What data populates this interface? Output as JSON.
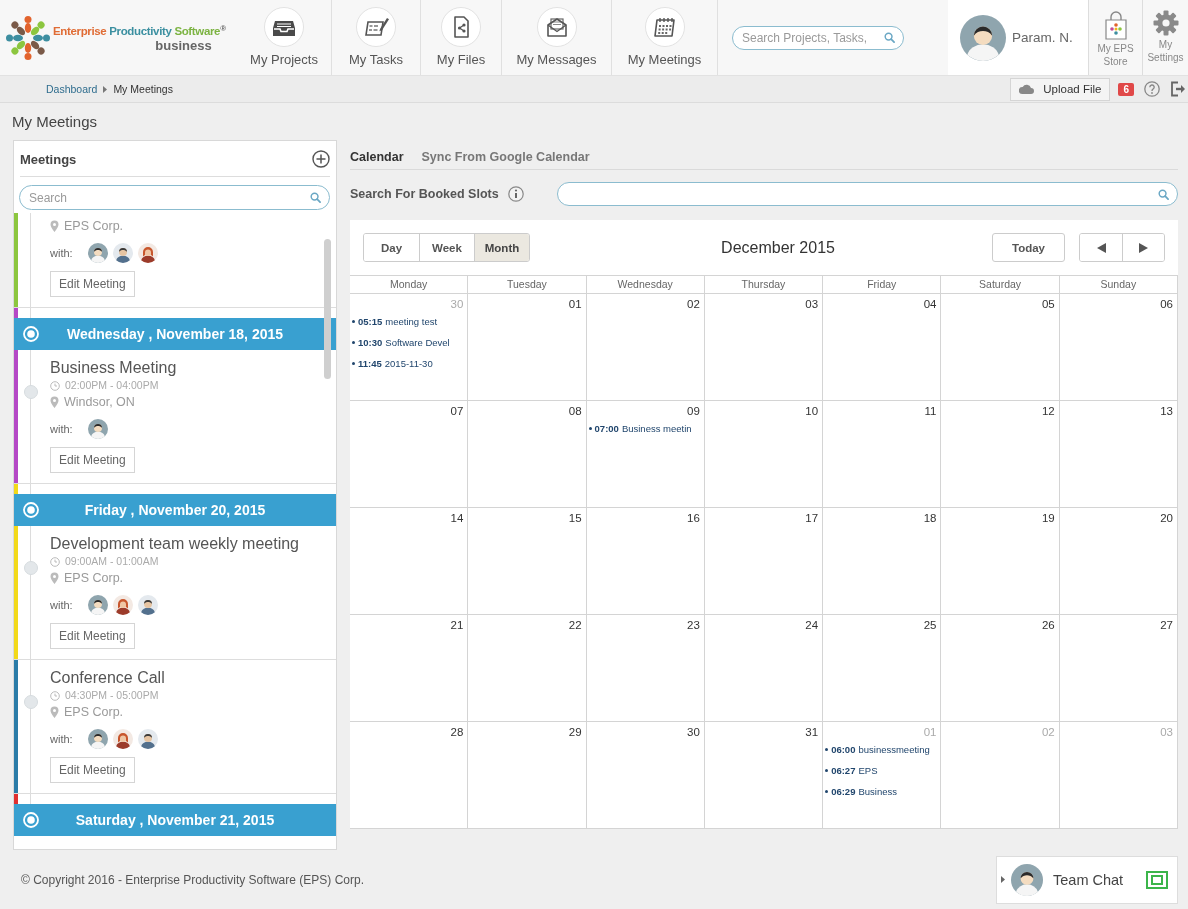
{
  "header": {
    "logo": {
      "words": [
        "Enterprise",
        "Productivity",
        "Software$^{®}$"
      ],
      "tagline": "business"
    },
    "nav": [
      {
        "label": "My Projects"
      },
      {
        "label": "My Tasks"
      },
      {
        "label": "My Files"
      },
      {
        "label": "My Messages"
      },
      {
        "label": "My Meetings"
      }
    ],
    "search": {
      "placeholder": "Search Projects, Tasks,"
    },
    "user": {
      "name": "Param. N."
    },
    "store": {
      "label": "My EPS Store"
    },
    "settings": {
      "label": "My Settings"
    }
  },
  "breadcrumb": [
    {
      "label": "Dashboard",
      "kind": "link"
    },
    {
      "label": "My Meetings",
      "kind": "current"
    }
  ],
  "toolbar": {
    "upload": "Upload File",
    "notifications": "6"
  },
  "page_title": "My Meetings",
  "meetings": {
    "title": "Meetings",
    "search": {
      "placeholder": "Search"
    },
    "list": [
      {
        "kind": "meeting",
        "location": "EPS Corp.",
        "with": "with:",
        "attendees": [
          {
            "kind": "man"
          },
          {
            "kind": "boy"
          },
          {
            "kind": "woman"
          }
        ],
        "button": "Edit Meeting",
        "color": "#8cc63f"
      },
      {
        "kind": "date",
        "label": "Wednesday , November 18, 2015",
        "color": "#b548c6"
      },
      {
        "kind": "meeting",
        "title": "Business Meeting",
        "time": "02:00PM - 04:00PM",
        "location": "Windsor, ON",
        "with": "with:",
        "attendees": [
          {
            "kind": "man"
          }
        ],
        "button": "Edit Meeting",
        "color": "#b548c6"
      },
      {
        "kind": "date",
        "label": "Friday , November 20, 2015",
        "color": "#f2d91a"
      },
      {
        "kind": "meeting",
        "title": "Development team weekly meeting",
        "time": "09:00AM - 01:00AM",
        "location": "EPS Corp.",
        "with": "with:",
        "attendees": [
          {
            "kind": "man"
          },
          {
            "kind": "woman"
          },
          {
            "kind": "boy"
          }
        ],
        "button": "Edit Meeting",
        "color": "#f2d91a"
      },
      {
        "kind": "meeting",
        "title": "Conference Call",
        "time": "04:30PM - 05:00PM",
        "location": "EPS Corp.",
        "with": "with:",
        "attendees": [
          {
            "kind": "man"
          },
          {
            "kind": "woman"
          },
          {
            "kind": "boy"
          }
        ],
        "button": "Edit Meeting",
        "color": "#2b7ca8"
      },
      {
        "kind": "date",
        "label": "Saturday , November 21, 2015",
        "color": "#e03030"
      }
    ]
  },
  "calendar_tabs": [
    {
      "label": "Calendar",
      "selected": true
    },
    {
      "label": "Sync From Google Calendar",
      "selected": false
    }
  ],
  "slot_search": {
    "label": "Search For Booked Slots"
  },
  "calendar": {
    "views": [
      {
        "label": "Day",
        "selected": false
      },
      {
        "label": "Week",
        "selected": false
      },
      {
        "label": "Month",
        "selected": true
      }
    ],
    "title": "December 2015",
    "today": "Today",
    "weekdays": [
      "Monday",
      "Tuesday",
      "Wednesday",
      "Thursday",
      "Friday",
      "Saturday",
      "Sunday"
    ],
    "weeks": [
      [
        {
          "day": "30",
          "other_month": true,
          "events": [
            {
              "time": "05:15",
              "title": "meeting test"
            },
            {
              "time": "10:30",
              "title": "Software Devel"
            },
            {
              "time": "11:45",
              "title": "2015-11-30"
            }
          ]
        },
        {
          "day": "01",
          "other_month": false
        },
        {
          "day": "02",
          "other_month": false
        },
        {
          "day": "03",
          "other_month": false
        },
        {
          "day": "04",
          "other_month": false
        },
        {
          "day": "05",
          "other_month": false
        },
        {
          "day": "06",
          "other_month": false
        }
      ],
      [
        {
          "day": "07",
          "other_month": false
        },
        {
          "day": "08",
          "other_month": false
        },
        {
          "day": "09",
          "other_month": false,
          "events": [
            {
              "time": "07:00",
              "title": "Business meetin"
            }
          ]
        },
        {
          "day": "10",
          "other_month": false
        },
        {
          "day": "11",
          "other_month": false
        },
        {
          "day": "12",
          "other_month": false
        },
        {
          "day": "13",
          "other_month": false
        }
      ],
      [
        {
          "day": "14",
          "other_month": false
        },
        {
          "day": "15",
          "other_month": false
        },
        {
          "day": "16",
          "other_month": false
        },
        {
          "day": "17",
          "other_month": false
        },
        {
          "day": "18",
          "other_month": false
        },
        {
          "day": "19",
          "other_month": false
        },
        {
          "day": "20",
          "other_month": false
        }
      ],
      [
        {
          "day": "21",
          "other_month": false
        },
        {
          "day": "22",
          "other_month": false
        },
        {
          "day": "23",
          "other_month": false
        },
        {
          "day": "24",
          "other_month": false
        },
        {
          "day": "25",
          "other_month": false
        },
        {
          "day": "26",
          "other_month": false
        },
        {
          "day": "27",
          "other_month": false
        }
      ],
      [
        {
          "day": "28",
          "other_month": false
        },
        {
          "day": "29",
          "other_month": false
        },
        {
          "day": "30",
          "other_month": false
        },
        {
          "day": "31",
          "other_month": false
        },
        {
          "day": "01",
          "other_month": true,
          "events": [
            {
              "time": "06:00",
              "title": "businessmeeting"
            },
            {
              "time": "06:27",
              "title": "EPS"
            },
            {
              "time": "06:29",
              "title": "Business"
            }
          ]
        },
        {
          "day": "02",
          "other_month": true
        },
        {
          "day": "03",
          "other_month": true
        }
      ]
    ]
  },
  "footer": {
    "copyright": "© Copyright 2016 - Enterprise Productivity Software (EPS) Corp.",
    "chat": "Team Chat"
  }
}
